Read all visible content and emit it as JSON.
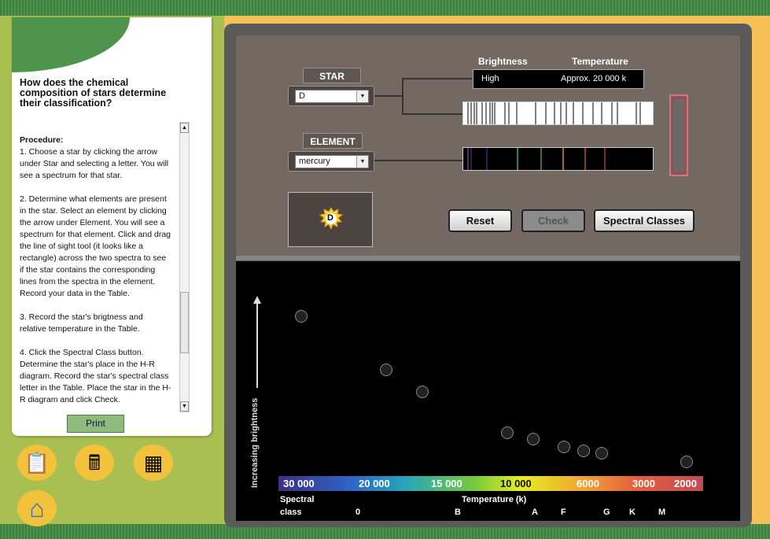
{
  "question": "How does the chemical composition of stars determine their classification?",
  "procedure": {
    "heading": "Procedure:",
    "paragraphs": [
      "1. Choose a star by clicking the arrow\nunder Star and selecting a letter. You will\nsee a spectrum for that star.",
      "2. Determine what elements are present\nin the star. Select an element by clicking\nthe arrow under Element. You will see a\nspectrum for that element. Click and drag\nthe line of sight tool (it looks like a\nrectangle) across the two spectra to see\nif the star contains the corresponding\nlines from the spectra in the element.\nRecord your data in the Table.",
      "3. Record the star's brigtness and\nrelative temperature in the Table.",
      "4. Click the Spectral Class button.\nDetermine the star's place in the H-R\ndiagram. Record the star's spectral class\nletter in the Table. Place the star in the H-\nR diagram and click Check."
    ]
  },
  "print_label": "Print",
  "tools": [
    {
      "name": "clipboard-icon",
      "glyph": "📋"
    },
    {
      "name": "calculator-icon",
      "glyph": "🖩"
    },
    {
      "name": "table-icon",
      "glyph": "▦"
    },
    {
      "name": "home-icon",
      "glyph": "⌂"
    }
  ],
  "star": {
    "label": "STAR",
    "value": "D"
  },
  "element": {
    "label": "ELEMENT",
    "value": "mercury"
  },
  "info": {
    "brightness_label": "Brightness",
    "temperature_label": "Temperature",
    "brightness_value": "High",
    "temperature_value": "Approx. 20 000 k"
  },
  "star_badge": "D",
  "buttons": {
    "reset": "Reset",
    "check": "Check",
    "spectral": "Spectral Classes"
  },
  "diagram": {
    "y_axis_label": "Increasing brightness",
    "temperature_ticks": [
      "30 000",
      "20 000",
      "15 000",
      "10 000",
      "6000",
      "3000",
      "2000"
    ],
    "temperature_label": "Temperature (k)",
    "spectral_label_line1": "Spectral",
    "spectral_label_line2": "class",
    "classes": [
      "0",
      "B",
      "A",
      "F",
      "G",
      "K",
      "M"
    ]
  },
  "colors": {
    "panel_bg": "#736862",
    "scale_start": "#3a3184",
    "scale_end": "#c24c56"
  }
}
